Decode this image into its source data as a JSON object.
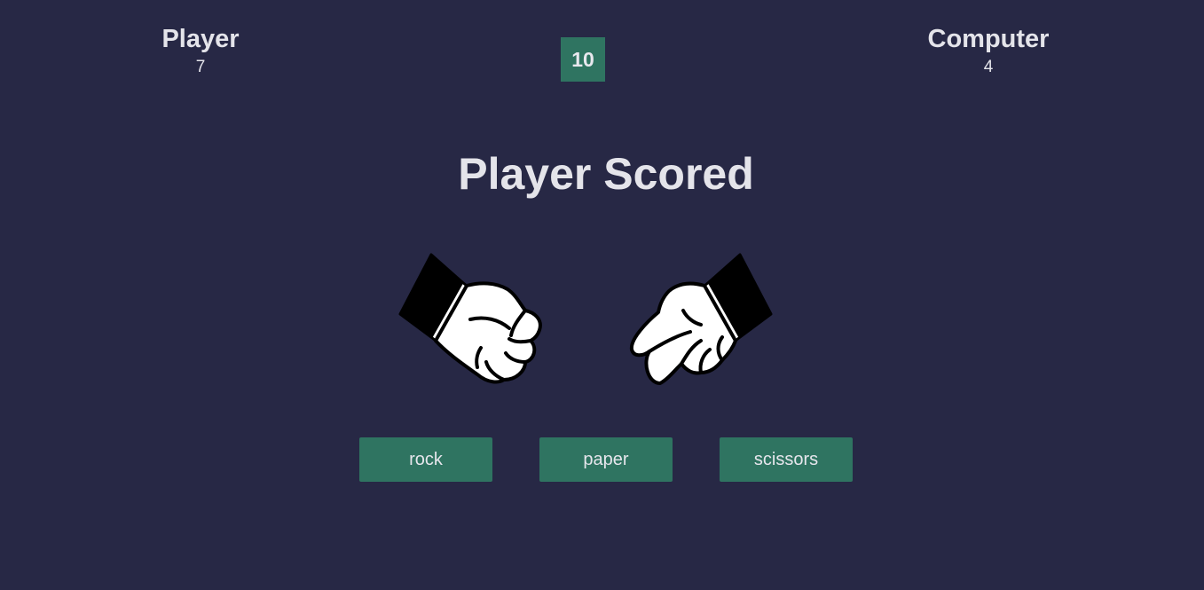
{
  "scoreboard": {
    "player": {
      "label": "Player",
      "score": "7"
    },
    "computer": {
      "label": "Computer",
      "score": "4"
    },
    "round": "10"
  },
  "result": {
    "message": "Player Scored"
  },
  "hands": {
    "player": {
      "icon": "rock-hand-icon"
    },
    "computer": {
      "icon": "scissors-hand-icon"
    }
  },
  "choices": {
    "rock": "rock",
    "paper": "paper",
    "scissors": "scissors"
  },
  "colors": {
    "background": "#272845",
    "accent": "#2f7461",
    "text": "#e4e4ea"
  }
}
